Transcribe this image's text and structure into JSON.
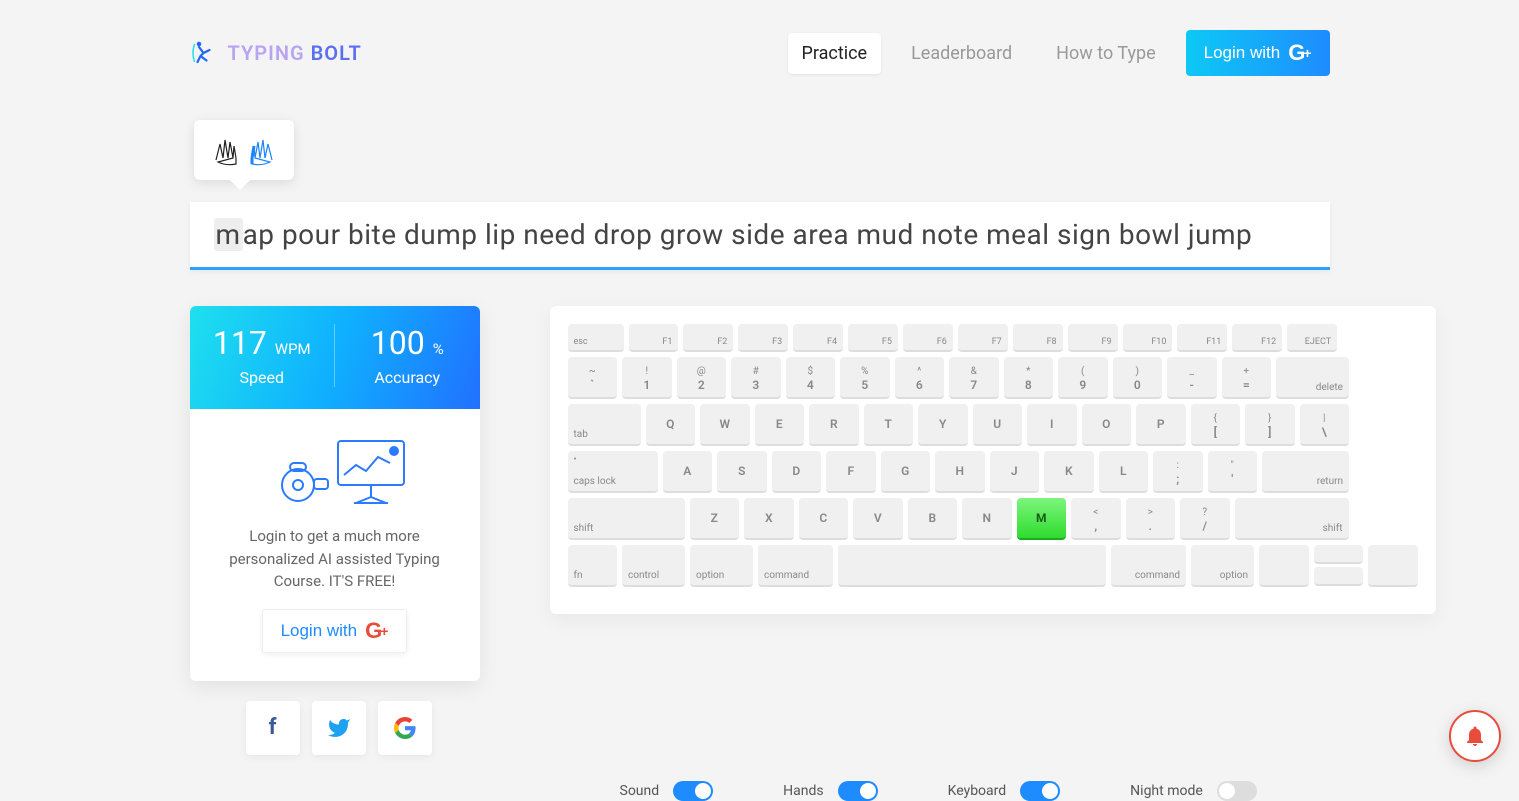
{
  "brand": {
    "part1": "TYPING",
    "part2": " BOLT"
  },
  "nav": {
    "practice": "Practice",
    "leaderboard": "Leaderboard",
    "howto": "How to Type",
    "login": "Login with"
  },
  "typing": {
    "current_char": "m",
    "rest": "ap pour bite dump lip need drop grow side area mud note meal sign bowl jump"
  },
  "stats": {
    "wpm_value": "117",
    "wpm_unit": "WPM",
    "wpm_label": "Speed",
    "acc_value": "100",
    "acc_unit": "%",
    "acc_label": "Accuracy",
    "message": "Login to get a much more personalized AI assisted Typing Course. IT'S FREE!",
    "login_btn": "Login with"
  },
  "keyboard": {
    "fn_row": [
      "esc",
      "F1",
      "F2",
      "F3",
      "F4",
      "F5",
      "F6",
      "F7",
      "F8",
      "F9",
      "F10",
      "F11",
      "F12",
      "EJECT"
    ],
    "num_row": [
      {
        "t": "~",
        "b": "`"
      },
      {
        "t": "!",
        "b": "1"
      },
      {
        "t": "@",
        "b": "2"
      },
      {
        "t": "#",
        "b": "3"
      },
      {
        "t": "$",
        "b": "4"
      },
      {
        "t": "%",
        "b": "5"
      },
      {
        "t": "^",
        "b": "6"
      },
      {
        "t": "&",
        "b": "7"
      },
      {
        "t": "*",
        "b": "8"
      },
      {
        "t": "(",
        "b": "9"
      },
      {
        "t": ")",
        "b": "0"
      },
      {
        "t": "_",
        "b": "-"
      },
      {
        "t": "+",
        "b": "="
      }
    ],
    "num_row_end": "delete",
    "r2_first": "tab",
    "r2": [
      "Q",
      "W",
      "E",
      "R",
      "T",
      "Y",
      "U",
      "I",
      "O",
      "P"
    ],
    "r2_bk1": {
      "t": "{",
      "b": "["
    },
    "r2_bk2": {
      "t": "}",
      "b": "]"
    },
    "r2_bk3": {
      "t": "|",
      "b": "\\"
    },
    "r3_first": "caps lock",
    "r3": [
      "A",
      "S",
      "D",
      "F",
      "G",
      "H",
      "J",
      "K",
      "L"
    ],
    "r3_sc": {
      "t": ":",
      "b": ";"
    },
    "r3_qu": {
      "t": "\"",
      "b": "'"
    },
    "r3_end": "return",
    "r4_first": "shift",
    "r4": [
      "Z",
      "X",
      "C",
      "V",
      "B",
      "N",
      "M"
    ],
    "r4_c1": {
      "t": "<",
      "b": ","
    },
    "r4_c2": {
      "t": ">",
      "b": "."
    },
    "r4_c3": {
      "t": "?",
      "b": "/"
    },
    "r4_end": "shift",
    "r5": [
      "fn",
      "control",
      "option",
      "command"
    ],
    "r5_right": [
      "command",
      "option"
    ],
    "active_key": "M"
  },
  "toggles": {
    "sound": {
      "label": "Sound",
      "on": true
    },
    "hands": {
      "label": "Hands",
      "on": true
    },
    "keyboard": {
      "label": "Keyboard",
      "on": true
    },
    "night": {
      "label": "Night mode",
      "on": false
    }
  }
}
